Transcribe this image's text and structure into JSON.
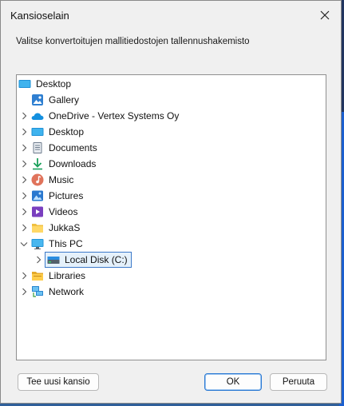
{
  "dialog": {
    "title": "Kansioselain",
    "instruction": "Valitse konvertoitujen mallitiedostojen tallennushakemisto"
  },
  "tree": {
    "root": {
      "label": "Desktop",
      "icon": "desktop-folder-icon"
    },
    "items": [
      {
        "label": "Gallery",
        "icon": "gallery-icon",
        "expander": "none"
      },
      {
        "label": "OneDrive - Vertex Systems Oy",
        "icon": "onedrive-cloud-icon",
        "expander": "collapsed"
      },
      {
        "label": "Desktop",
        "icon": "desktop-folder-icon",
        "expander": "collapsed"
      },
      {
        "label": "Documents",
        "icon": "documents-icon",
        "expander": "collapsed"
      },
      {
        "label": "Downloads",
        "icon": "download-arrow-icon",
        "expander": "collapsed"
      },
      {
        "label": "Music",
        "icon": "music-icon",
        "expander": "collapsed"
      },
      {
        "label": "Pictures",
        "icon": "pictures-icon",
        "expander": "collapsed"
      },
      {
        "label": "Videos",
        "icon": "videos-icon",
        "expander": "collapsed"
      },
      {
        "label": "JukkaS",
        "icon": "folder-icon",
        "expander": "collapsed"
      },
      {
        "label": "This PC",
        "icon": "computer-monitor-icon",
        "expander": "expanded"
      },
      {
        "label": "Local Disk (C:)",
        "icon": "drive-icon",
        "expander": "collapsed",
        "selected": true
      },
      {
        "label": "Libraries",
        "icon": "libraries-icon",
        "expander": "collapsed"
      },
      {
        "label": "Network",
        "icon": "network-icon",
        "expander": "collapsed"
      }
    ]
  },
  "buttons": {
    "new_folder": "Tee uusi kansio",
    "ok": "OK",
    "cancel": "Peruuta"
  },
  "colors": {
    "selection_border": "#3c79c9",
    "selection_fill": "#e5f1fb",
    "primary_border": "#2b7ad4"
  }
}
